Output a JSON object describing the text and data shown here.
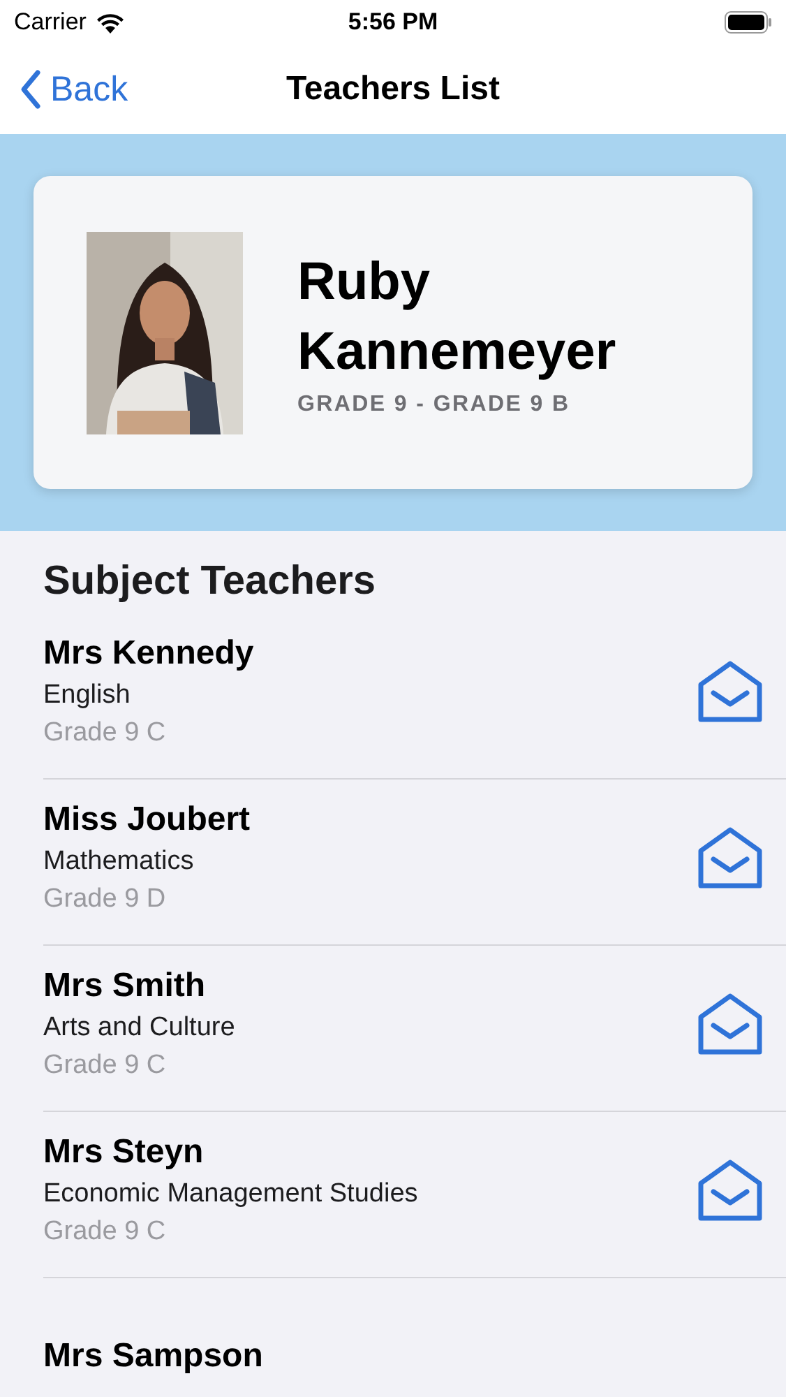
{
  "status_bar": {
    "carrier": "Carrier",
    "time": "5:56 PM"
  },
  "nav": {
    "back": "Back",
    "title": "Teachers List"
  },
  "student": {
    "name": "Ruby Kannemeyer",
    "class": "GRADE 9 - GRADE 9 B"
  },
  "section_title": "Subject Teachers",
  "teachers": [
    {
      "name": "Mrs Kennedy",
      "subject": "English",
      "class": "Grade 9 C"
    },
    {
      "name": "Miss Joubert",
      "subject": "Mathematics",
      "class": "Grade 9 D"
    },
    {
      "name": "Mrs Smith",
      "subject": "Arts and Culture",
      "class": "Grade 9 C"
    },
    {
      "name": "Mrs Steyn",
      "subject": "Economic Management Studies",
      "class": "Grade 9 C"
    },
    {
      "name": "Mrs Sampson"
    }
  ]
}
